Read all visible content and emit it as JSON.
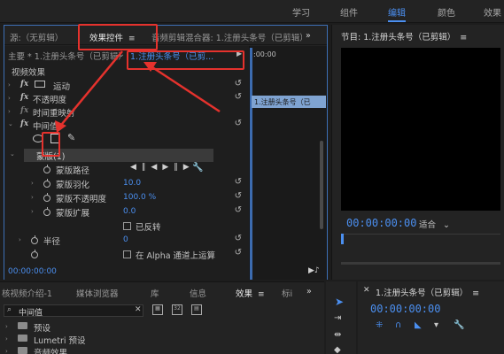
{
  "workspaces": [
    {
      "label": "学习"
    },
    {
      "label": "组件"
    },
    {
      "label": "编辑"
    },
    {
      "label": "颜色"
    },
    {
      "label": "效果"
    }
  ],
  "effect_controls": {
    "tabs": {
      "source": "源:（无剪辑）",
      "effect_controls": "效果控件",
      "audio_mixer": "音频剪辑混合器: 1.注册头条号（已剪辑）"
    },
    "master_label": "主要 * 1.注册头条号（已剪辑）",
    "clip_label": "1.注册头条号（已剪...",
    "ruler_time": ":00:00",
    "clip_bar_label": "1.注册头条号（已",
    "section_video_effects": "视频效果",
    "effects": [
      {
        "label": "运动"
      },
      {
        "label": "不透明度"
      },
      {
        "label": "时间重映射"
      },
      {
        "label": "中间值"
      }
    ],
    "mask_label": "蒙版(1)",
    "mask_props": [
      {
        "label": "蒙版路径",
        "value": ""
      },
      {
        "label": "蒙版羽化",
        "value": "10.0"
      },
      {
        "label": "蒙版不透明度",
        "value": "100.0 %"
      },
      {
        "label": "蒙版扩展",
        "value": "0.0"
      }
    ],
    "inverted_label": "已反转",
    "radius_label": "半径",
    "radius_value": "0",
    "alpha_label": "在 Alpha 通道上运算",
    "footer_time": "00:00:00:00"
  },
  "program_monitor": {
    "title": "节目: 1.注册头条号（已剪辑）",
    "timecode": "00:00:00:00",
    "fit_label": "适合"
  },
  "project_panel": {
    "tabs": [
      {
        "label": "核视频介绍-1"
      },
      {
        "label": "媒体浏览器"
      },
      {
        "label": "库"
      },
      {
        "label": "信息"
      },
      {
        "label": "效果"
      },
      {
        "label": "标i"
      }
    ],
    "search_value": "中间值",
    "folders": [
      {
        "label": "预设"
      },
      {
        "label": "Lumetri 预设"
      },
      {
        "label": "音频效果"
      }
    ]
  },
  "timeline": {
    "title": "1.注册头条号（已剪辑）",
    "timecode": "00:00:00:00"
  }
}
